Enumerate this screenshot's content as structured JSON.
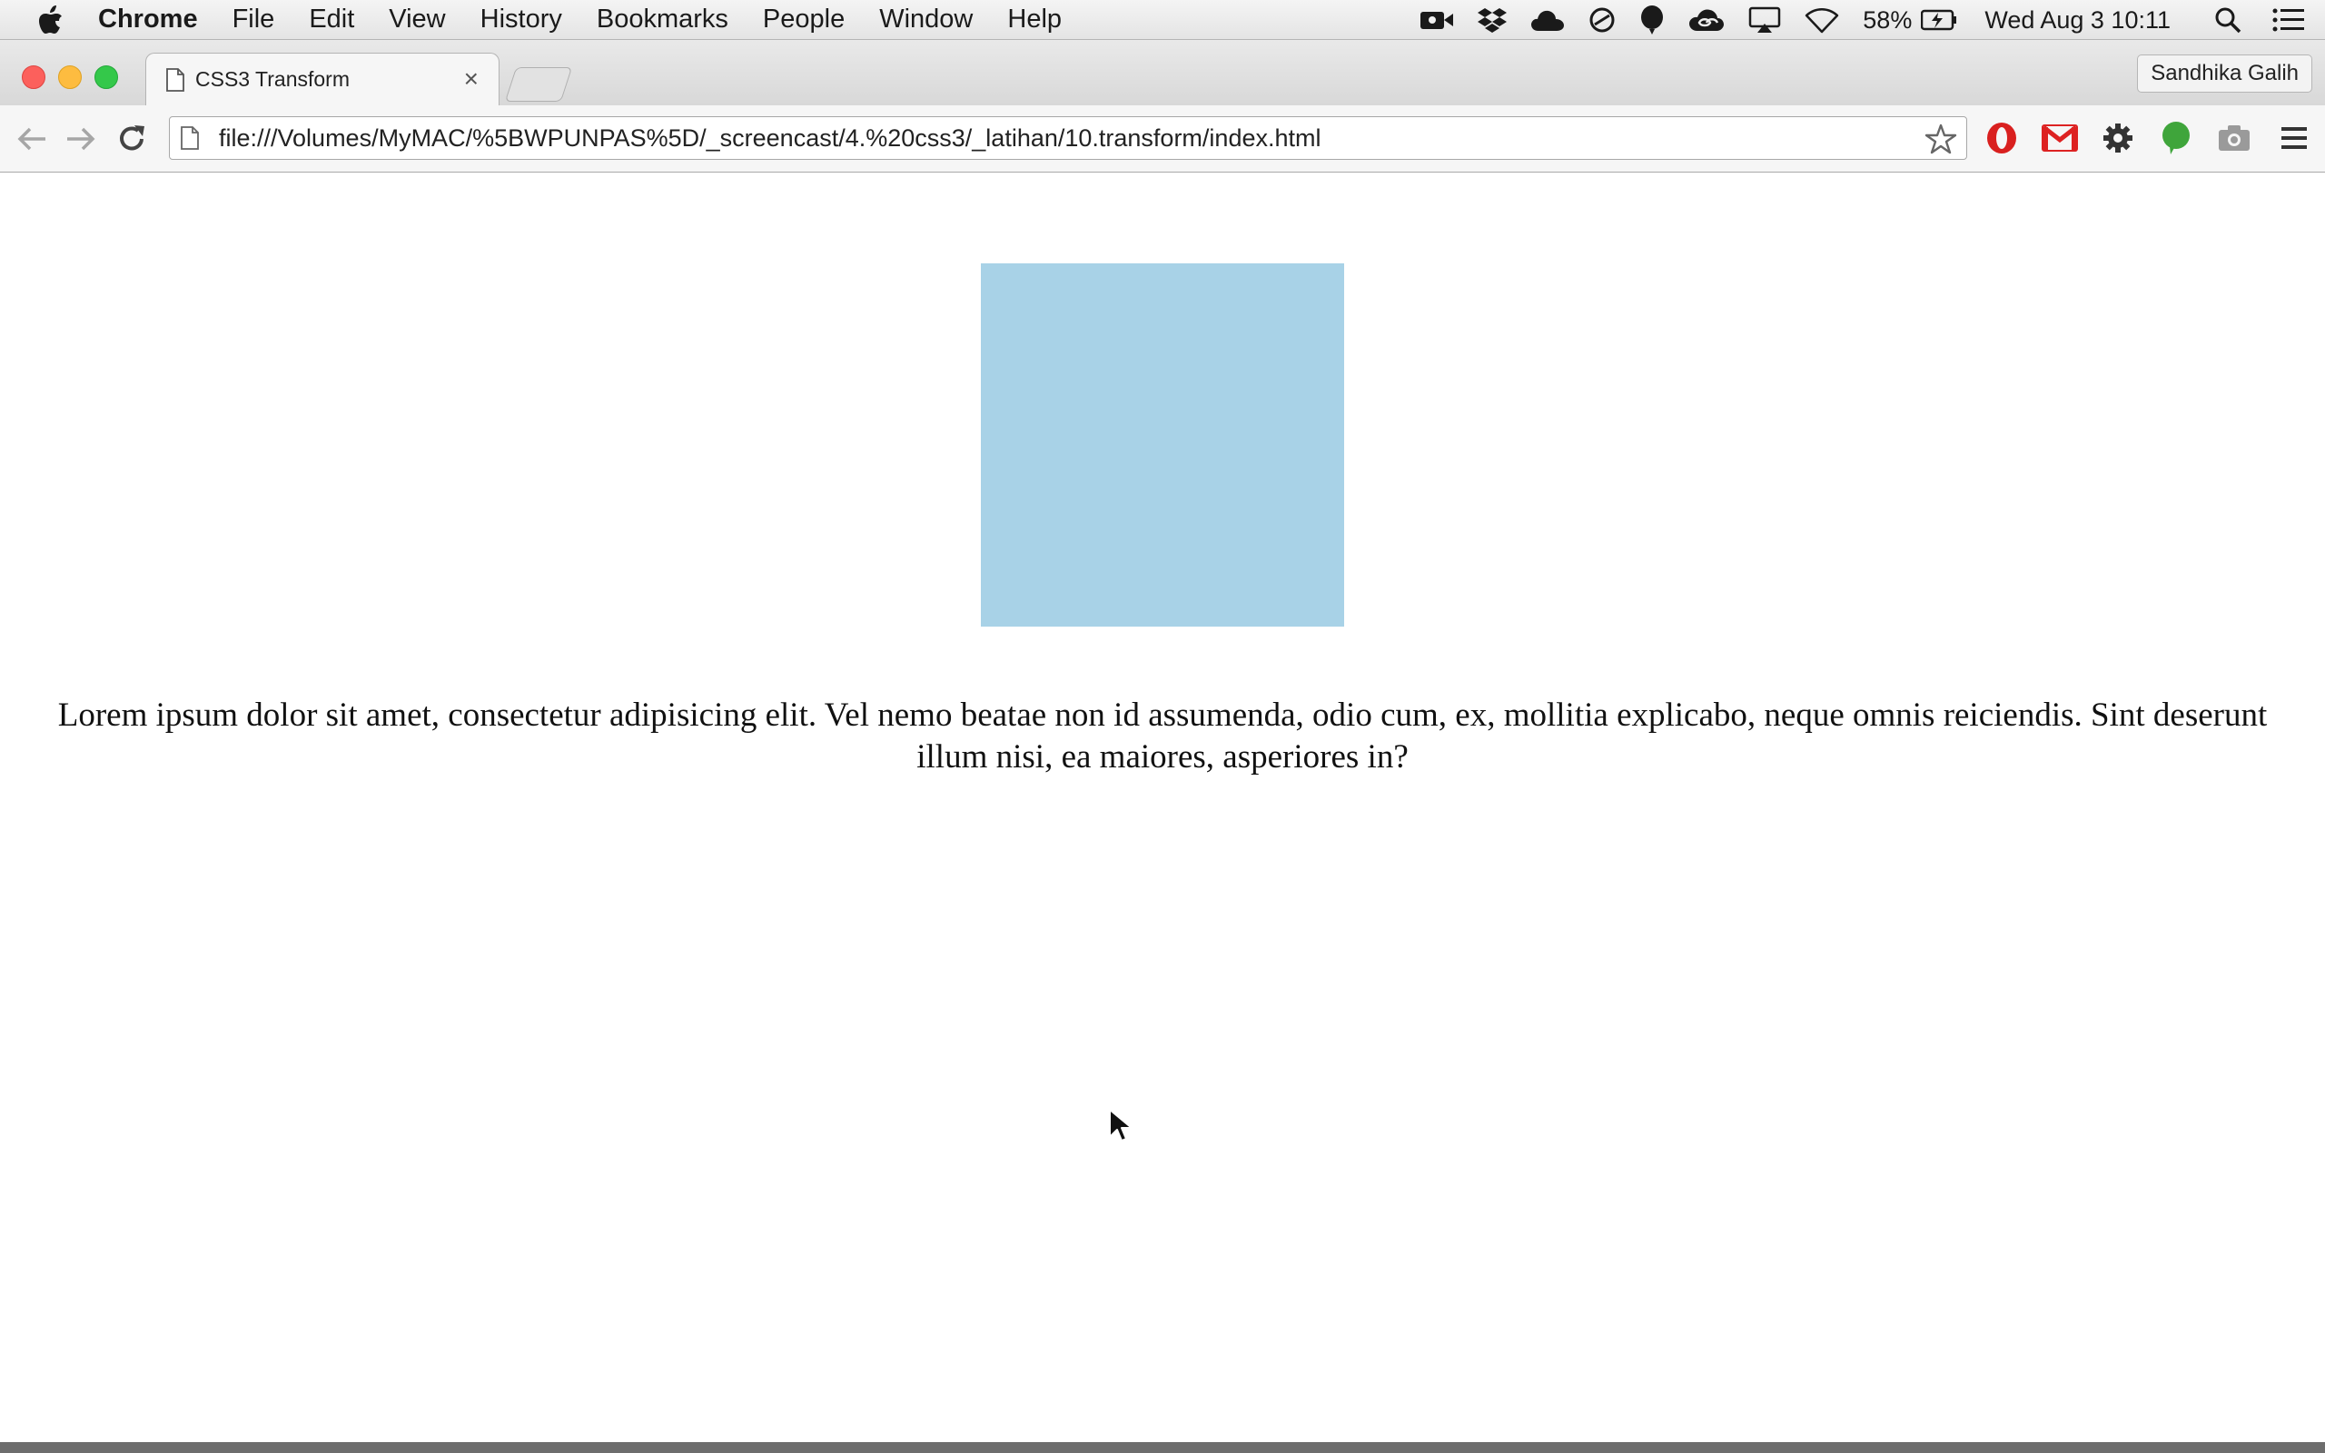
{
  "menubar": {
    "app_name": "Chrome",
    "items": [
      "File",
      "Edit",
      "View",
      "History",
      "Bookmarks",
      "People",
      "Window",
      "Help"
    ],
    "battery": "58%",
    "clock": "Wed Aug 3  10:11"
  },
  "browser": {
    "tab_title": "CSS3 Transform",
    "tab_close": "×",
    "profile_name": "Sandhika Galih",
    "url": "file:///Volumes/MyMAC/%5BWPUNPAS%5D/_screencast/4.%20css3/_latihan/10.transform/index.html"
  },
  "page": {
    "box_color": "#a8d2e7",
    "paragraph": "Lorem ipsum dolor sit amet, consectetur adipisicing elit. Vel nemo beatae non id assumenda, odio cum, ex, mollitia explicabo, neque omnis reiciendis. Sint deserunt illum nisi, ea maiores, asperiores in?"
  },
  "icons": {
    "status": [
      "facetime-camera-icon",
      "dropbox-icon",
      "cloud-icon",
      "sync-icon",
      "balloon-icon",
      "creative-cloud-icon",
      "airplay-icon",
      "wifi-icon",
      "battery-charging-icon",
      "spotlight-search-icon",
      "notification-center-icon"
    ],
    "extensions": [
      "opera-icon",
      "gmail-icon",
      "settings-gear-icon",
      "evernote-icon",
      "camera-icon",
      "chrome-menu-icon"
    ]
  }
}
